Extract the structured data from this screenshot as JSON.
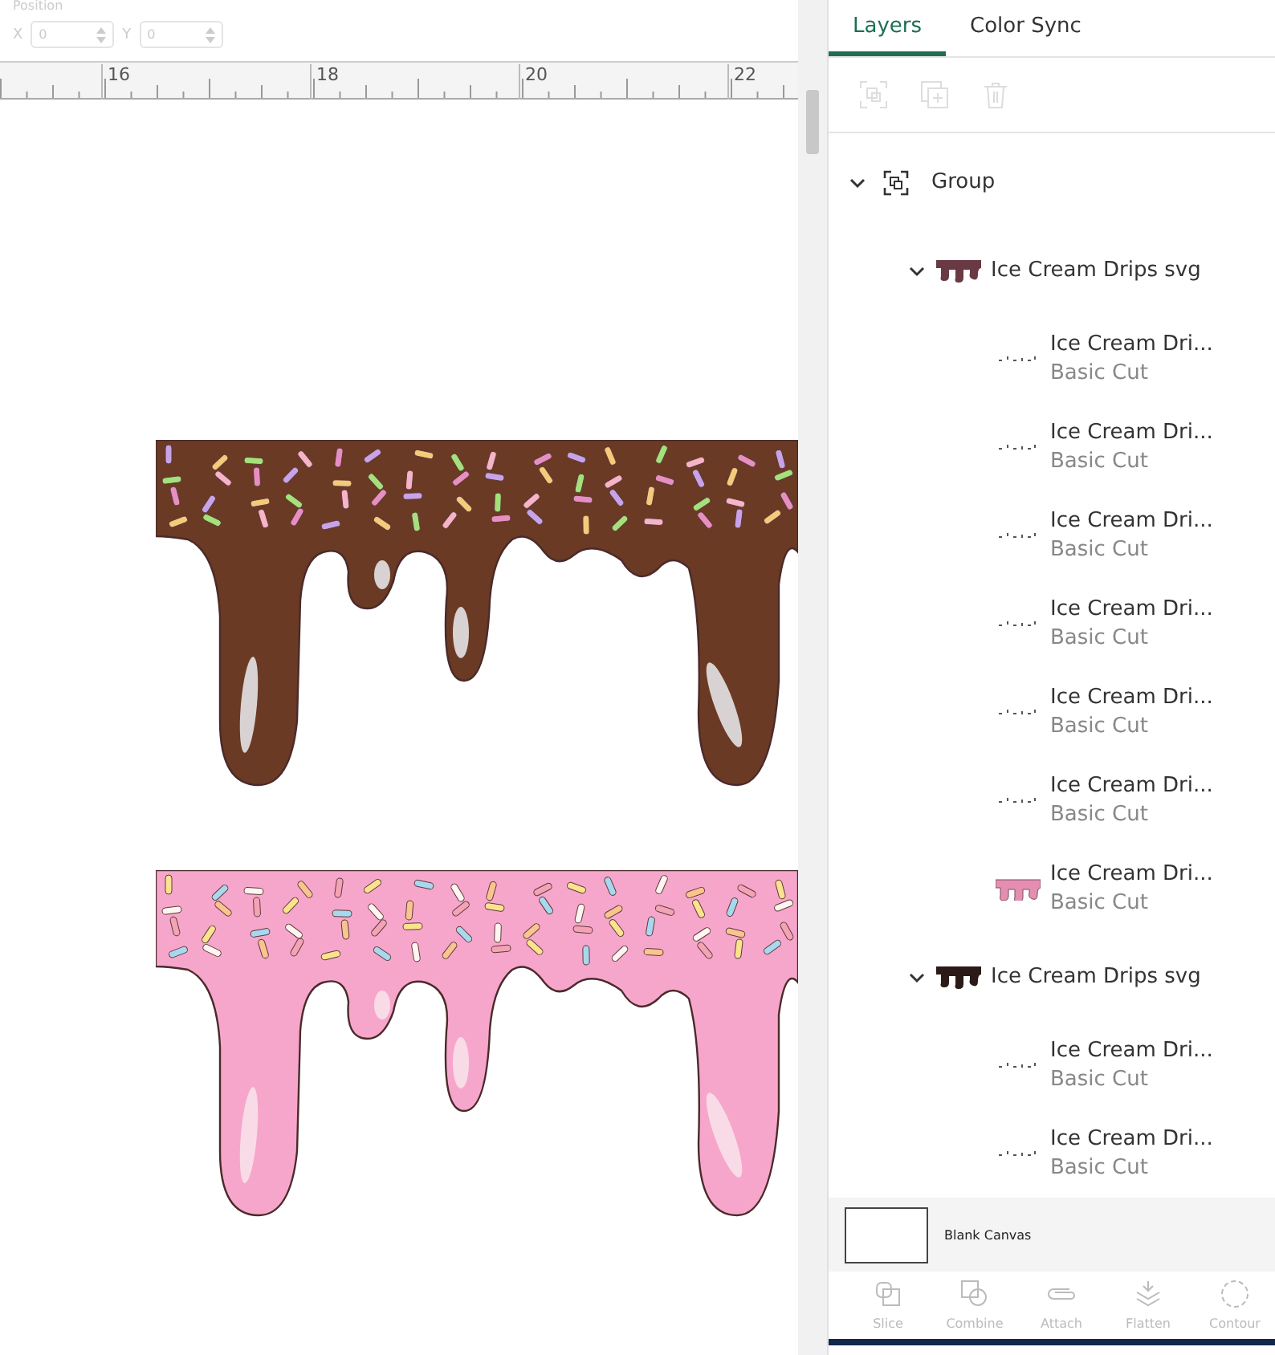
{
  "position": {
    "label": "Position",
    "fields": [
      {
        "label": "X",
        "value": "0",
        "disabled": true
      },
      {
        "label": "Y",
        "value": "0",
        "disabled": true
      }
    ]
  },
  "ruler": {
    "labels": [
      "16",
      "18",
      "20",
      "22"
    ]
  },
  "canvas": {
    "drips": [
      {
        "kind": "chocolate"
      },
      {
        "kind": "pink"
      }
    ]
  },
  "tabs": [
    {
      "label": "Layers",
      "selected": true
    },
    {
      "label": "Color Sync",
      "selected": false
    }
  ],
  "layer_tools": [
    {
      "kind": "group",
      "disabled": true
    },
    {
      "kind": "duplicate",
      "disabled": true
    },
    {
      "kind": "delete",
      "disabled": true
    }
  ],
  "layers": [
    {
      "name": "Group",
      "kind": "group",
      "expanded": true,
      "children": [
        {
          "name": "Ice Cream Drips svg",
          "kind": "chocolate",
          "expanded": true,
          "children": [
            {
              "name": "Ice Cream Dri...",
              "operation": "Basic Cut",
              "kind": "dots"
            },
            {
              "name": "Ice Cream Dri...",
              "operation": "Basic Cut",
              "kind": "dots"
            },
            {
              "name": "Ice Cream Dri...",
              "operation": "Basic Cut",
              "kind": "dots"
            },
            {
              "name": "Ice Cream Dri...",
              "operation": "Basic Cut",
              "kind": "dots"
            },
            {
              "name": "Ice Cream Dri...",
              "operation": "Basic Cut",
              "kind": "dots"
            },
            {
              "name": "Ice Cream Dri...",
              "operation": "Basic Cut",
              "kind": "dots"
            },
            {
              "name": "Ice Cream Dri...",
              "operation": "Basic Cut",
              "kind": "pink"
            }
          ]
        },
        {
          "name": "Ice Cream Drips svg",
          "kind": "dark",
          "expanded": true,
          "children": [
            {
              "name": "Ice Cream Dri...",
              "operation": "Basic Cut",
              "kind": "dots"
            },
            {
              "name": "Ice Cream Dri...",
              "operation": "Basic Cut",
              "kind": "dots"
            }
          ]
        }
      ]
    }
  ],
  "blank_canvas": {
    "label": "Blank Canvas"
  },
  "actions": [
    {
      "label": "Slice",
      "kind": "slice",
      "disabled": true
    },
    {
      "label": "Combine",
      "kind": "combine",
      "disabled": true
    },
    {
      "label": "Attach",
      "kind": "attach",
      "disabled": true
    },
    {
      "label": "Flatten",
      "kind": "flatten",
      "disabled": true
    },
    {
      "label": "Contour",
      "kind": "contour",
      "disabled": true
    }
  ]
}
